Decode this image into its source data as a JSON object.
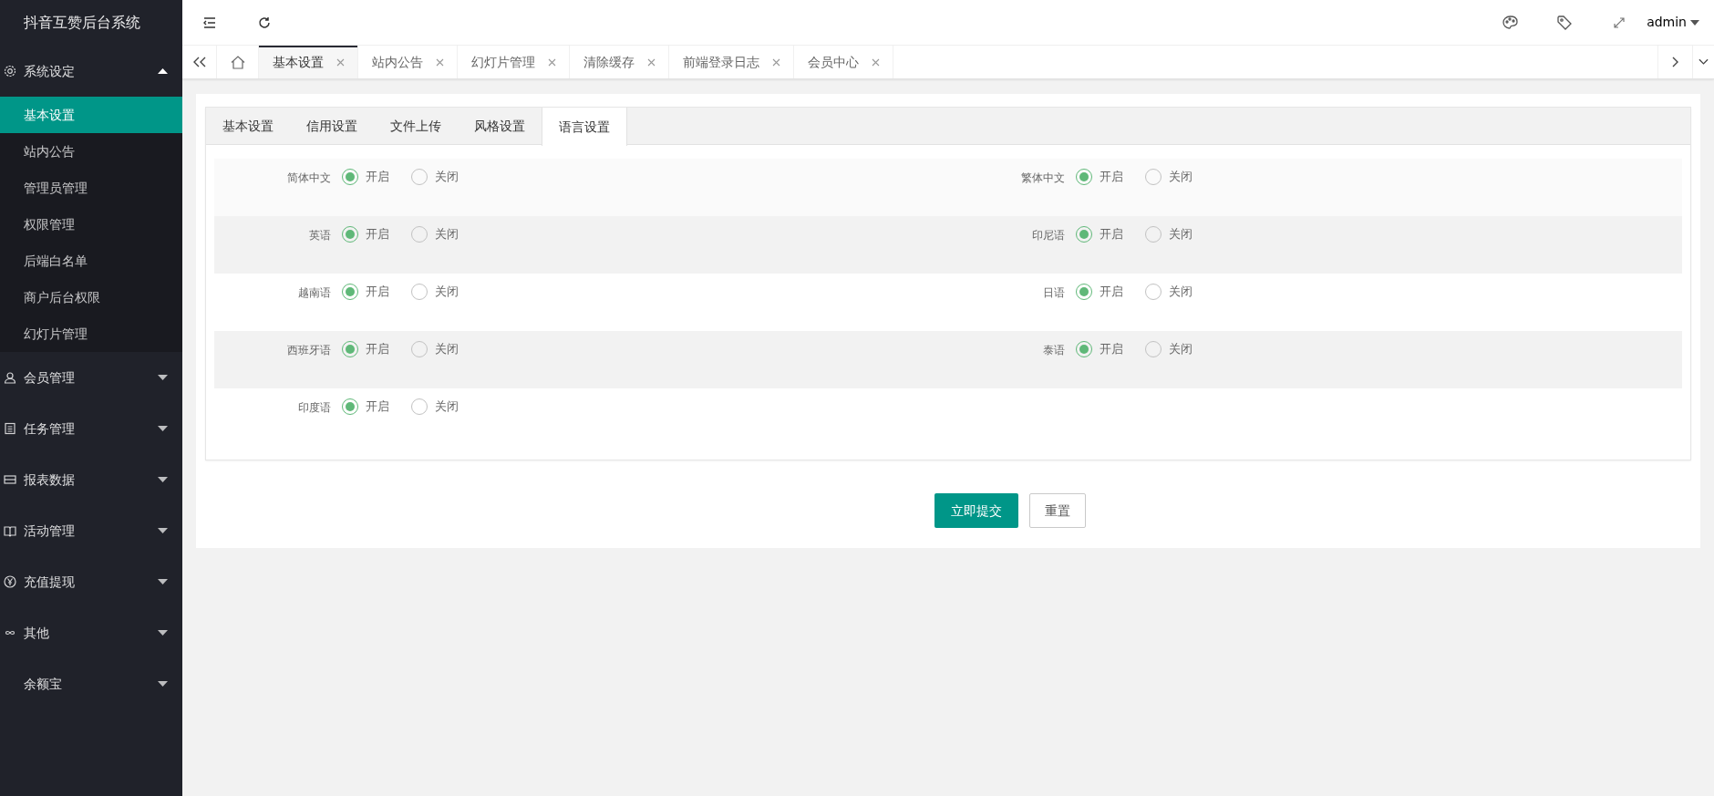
{
  "app_title": "抖音互赞后台系统",
  "sidebar": {
    "items": [
      {
        "label": "系统设定",
        "kind": "gear",
        "expanded": true,
        "children": [
          {
            "label": "基本设置",
            "selected": true
          },
          {
            "label": "站内公告",
            "selected": false
          },
          {
            "label": "管理员管理",
            "selected": false
          },
          {
            "label": "权限管理",
            "selected": false
          },
          {
            "label": "后端白名单",
            "selected": false
          },
          {
            "label": "商户后台权限",
            "selected": false
          },
          {
            "label": "幻灯片管理",
            "selected": false
          }
        ]
      },
      {
        "label": "会员管理",
        "kind": "user",
        "expanded": false
      },
      {
        "label": "任务管理",
        "kind": "doc",
        "expanded": false
      },
      {
        "label": "报表数据",
        "kind": "table",
        "expanded": false
      },
      {
        "label": "活动管理",
        "kind": "book",
        "expanded": false
      },
      {
        "label": "充值提现",
        "kind": "yen",
        "expanded": false
      },
      {
        "label": "其他",
        "kind": "infinity",
        "expanded": false
      },
      {
        "label": "余额宝",
        "kind": "plain",
        "expanded": false
      }
    ]
  },
  "header": {
    "user": "admin"
  },
  "page_tabs": [
    {
      "label": "基本设置",
      "selected": true
    },
    {
      "label": "站内公告",
      "selected": false
    },
    {
      "label": "幻灯片管理",
      "selected": false
    },
    {
      "label": "清除缓存",
      "selected": false
    },
    {
      "label": "前端登录日志",
      "selected": false
    },
    {
      "label": "会员中心",
      "selected": false
    }
  ],
  "settings_tabs": [
    {
      "label": "基本设置",
      "selected": false
    },
    {
      "label": "信用设置",
      "selected": false
    },
    {
      "label": "文件上传",
      "selected": false
    },
    {
      "label": "风格设置",
      "selected": false
    },
    {
      "label": "语言设置",
      "selected": true
    }
  ],
  "languages": [
    {
      "label": "简体中文",
      "options": [
        {
          "label": "开启",
          "selected": true
        },
        {
          "label": "关闭",
          "selected": false
        }
      ]
    },
    {
      "label": "繁体中文",
      "options": [
        {
          "label": "开启",
          "selected": true
        },
        {
          "label": "关闭",
          "selected": false
        }
      ]
    },
    {
      "label": "英语",
      "options": [
        {
          "label": "开启",
          "selected": true
        },
        {
          "label": "关闭",
          "selected": false
        }
      ]
    },
    {
      "label": "印尼语",
      "options": [
        {
          "label": "开启",
          "selected": true
        },
        {
          "label": "关闭",
          "selected": false
        }
      ]
    },
    {
      "label": "越南语",
      "options": [
        {
          "label": "开启",
          "selected": true
        },
        {
          "label": "关闭",
          "selected": false
        }
      ]
    },
    {
      "label": "日语",
      "options": [
        {
          "label": "开启",
          "selected": true
        },
        {
          "label": "关闭",
          "selected": false
        }
      ]
    },
    {
      "label": "西班牙语",
      "options": [
        {
          "label": "开启",
          "selected": true
        },
        {
          "label": "关闭",
          "selected": false
        }
      ]
    },
    {
      "label": "泰语",
      "options": [
        {
          "label": "开启",
          "selected": true
        },
        {
          "label": "关闭",
          "selected": false
        }
      ]
    },
    {
      "label": "印度语",
      "options": [
        {
          "label": "开启",
          "selected": true
        },
        {
          "label": "关闭",
          "selected": false
        }
      ]
    }
  ],
  "buttons": {
    "submit": "立即提交",
    "reset": "重置"
  }
}
